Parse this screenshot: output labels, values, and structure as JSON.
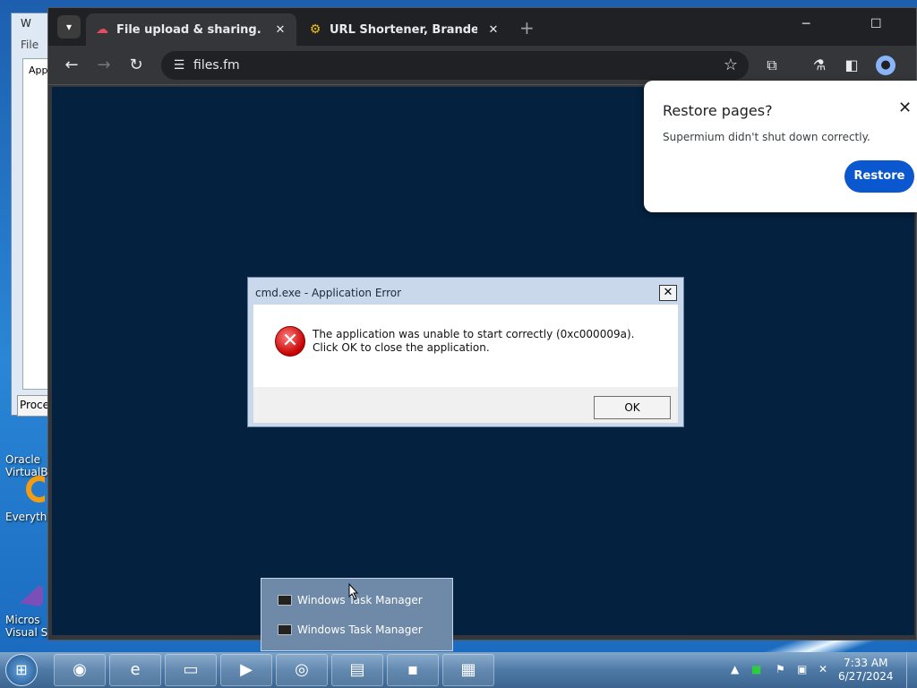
{
  "background_window": {
    "title_partial": "W",
    "menu_file": "File",
    "pane_text": "App",
    "proc_button": "Proce"
  },
  "desktop_icons": [
    {
      "label": "Oracle\nVirtualB",
      "icon": "virtualbox-icon"
    },
    {
      "label": "Everyth",
      "icon": "everything-icon"
    },
    {
      "label": "Micros\nVisual St",
      "icon": "visual-studio-icon"
    }
  ],
  "browser": {
    "tabs": [
      {
        "label": "File upload & sharing. Send large",
        "icon": "cloud-icon",
        "active": true
      },
      {
        "label": "URL Shortener, Branded Short",
        "icon": "link-icon",
        "active": false
      }
    ],
    "url": "files.fm"
  },
  "restore_popup": {
    "title": "Restore pages?",
    "message": "Supermium didn't shut down correctly.",
    "button": "Restore"
  },
  "error_dialog": {
    "title": "cmd.exe - Application Error",
    "message": "The application was unable to start correctly (0xc000009a). Click OK to close the application.",
    "ok_label": "OK"
  },
  "jump_list": {
    "items": [
      "Windows Task Manager",
      "Windows Task Manager"
    ]
  },
  "taskbar": {
    "apps": [
      "app-icon",
      "internet-explorer-icon",
      "file-explorer-icon",
      "media-player-icon",
      "disc-icon",
      "task-manager-icon",
      "cmd-icon",
      "notepad-icon"
    ],
    "time": "7:33 AM",
    "date": "6/27/2024"
  },
  "colors": {
    "browser_content": "#04213f",
    "restore_button": "#0b57d0",
    "error_red": "#c40000"
  }
}
